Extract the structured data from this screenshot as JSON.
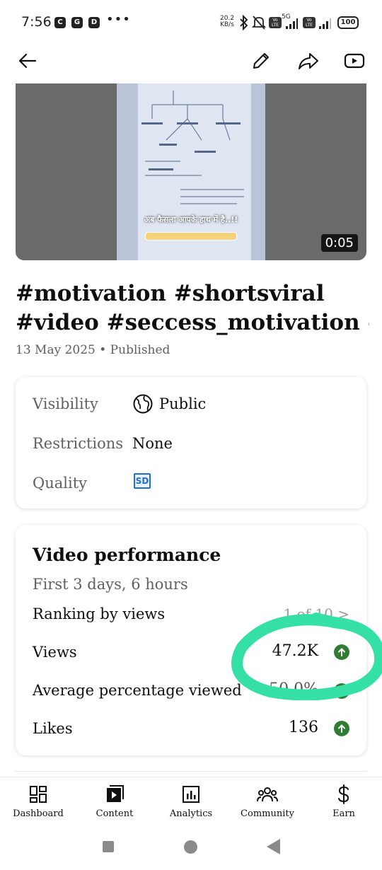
{
  "status_bar": {
    "time": "7:56",
    "app_icons": [
      "C",
      "G",
      "D"
    ],
    "more": "•••",
    "speed_value": "20.2",
    "speed_unit": "KB/s",
    "network": "5G",
    "volte_label": "Vo LTE",
    "battery": "100"
  },
  "app_bar": {
    "icons": [
      "back-arrow-icon",
      "edit-pencil-icon",
      "share-icon",
      "youtube-icon"
    ]
  },
  "video": {
    "caption": "अब फैसला आपके हाथ में है..!!",
    "duration": "0:05"
  },
  "title": {
    "line1": "#motivation #shortsviral",
    "line2": "#video #seccess_motivation #i..."
  },
  "meta": "13 May 2025 • Published",
  "details": {
    "visibility_label": "Visibility",
    "visibility_value": "Public",
    "restrictions_label": "Restrictions",
    "restrictions_value": "None",
    "quality_label": "Quality",
    "quality_value": "SD"
  },
  "performance": {
    "title": "Video performance",
    "subtitle": "First 3 days, 6 hours",
    "ranking_label": "Ranking by views",
    "ranking_value": "1 of 10 >",
    "views_label": "Views",
    "views_value": "47.2K",
    "avg_label": "Average percentage viewed",
    "avg_value": "50.0%",
    "likes_label": "Likes",
    "likes_value": "136",
    "trend_color": "#2e7d32",
    "highlight_color": "#35e0a6"
  },
  "bottom_nav": {
    "items": [
      {
        "label": "Dashboard",
        "icon": "dashboard-icon"
      },
      {
        "label": "Content",
        "icon": "content-play-icon"
      },
      {
        "label": "Analytics",
        "icon": "analytics-icon"
      },
      {
        "label": "Community",
        "icon": "community-icon"
      },
      {
        "label": "Earn",
        "icon": "dollar-icon"
      }
    ]
  }
}
